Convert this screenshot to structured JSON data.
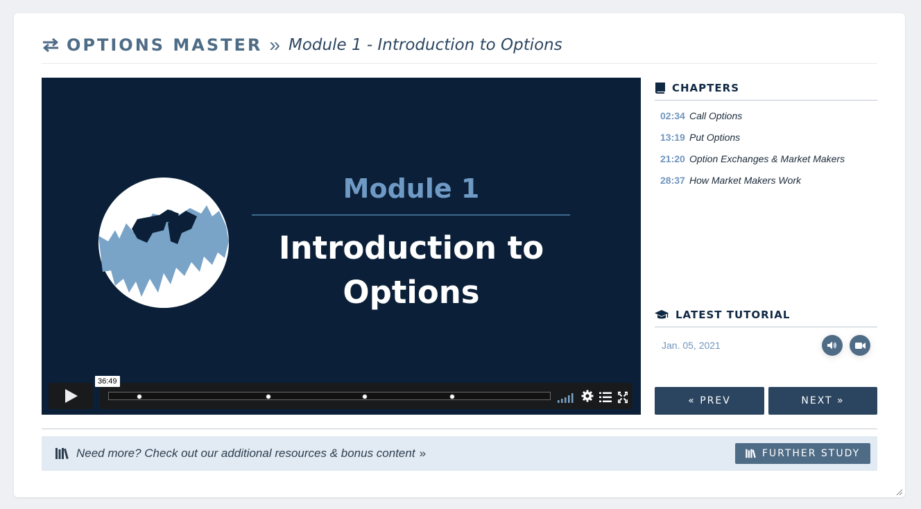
{
  "header": {
    "brand": "OPTIONS MASTER",
    "separator": "»",
    "subtitle": "Module 1 - Introduction to Options"
  },
  "video": {
    "slide_module": "Module 1",
    "slide_title_line1": "Introduction to",
    "slide_title_line2": "Options",
    "duration": "36:49",
    "progress": 0
  },
  "chapters": {
    "title": "CHAPTERS",
    "items": [
      {
        "time": "02:34",
        "title": "Call Options"
      },
      {
        "time": "13:19",
        "title": "Put Options"
      },
      {
        "time": "21:20",
        "title": "Option Exchanges & Market Makers"
      },
      {
        "time": "28:37",
        "title": "How Market Makers Work"
      }
    ]
  },
  "latest_tutorial": {
    "title": "LATEST TUTORIAL",
    "date": "Jan. 05, 2021"
  },
  "nav": {
    "prev_label": "« PREV",
    "next_label": "NEXT »"
  },
  "resources": {
    "text": "Need more? Check out our additional resources & bonus content",
    "more_glyph": "»",
    "button_label": "FURTHER STUDY"
  },
  "colors": {
    "accent": "#4f6c87",
    "dark_navy": "#0b2038",
    "button_dark": "#2b4560",
    "link_blue": "#6f95be",
    "resource_bg": "#e2ebf3"
  },
  "icons": {
    "header": "swap-arrows-icon",
    "chapters": "book-icon",
    "tutorial": "graduation-cap-icon",
    "audio": "volume-icon",
    "video": "video-camera-icon",
    "resources": "library-icon"
  }
}
